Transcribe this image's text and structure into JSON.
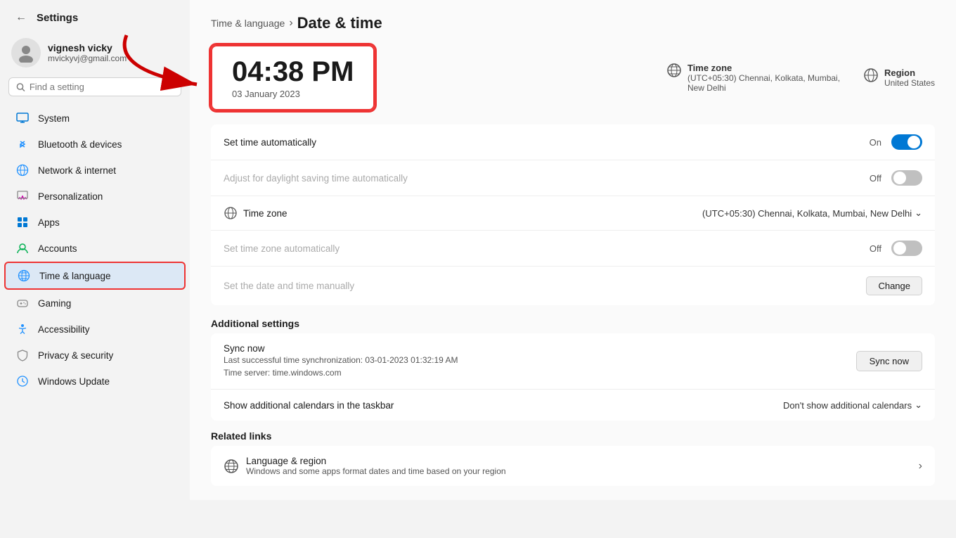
{
  "window": {
    "title": "Settings"
  },
  "user": {
    "name": "vignesh vicky",
    "email": "mvickyvj@gmail.com",
    "avatar_icon": "👤"
  },
  "search": {
    "placeholder": "Find a setting"
  },
  "nav": {
    "items": [
      {
        "id": "system",
        "label": "System",
        "icon": "🖥️",
        "active": false
      },
      {
        "id": "bluetooth",
        "label": "Bluetooth & devices",
        "icon": "🔵",
        "active": false
      },
      {
        "id": "network",
        "label": "Network & internet",
        "icon": "🌐",
        "active": false
      },
      {
        "id": "personalization",
        "label": "Personalization",
        "icon": "✏️",
        "active": false
      },
      {
        "id": "apps",
        "label": "Apps",
        "icon": "🧩",
        "active": false
      },
      {
        "id": "accounts",
        "label": "Accounts",
        "icon": "👤",
        "active": false
      },
      {
        "id": "time-language",
        "label": "Time & language",
        "icon": "🌍",
        "active": true
      },
      {
        "id": "gaming",
        "label": "Gaming",
        "icon": "🎮",
        "active": false
      },
      {
        "id": "accessibility",
        "label": "Accessibility",
        "icon": "♿",
        "active": false
      },
      {
        "id": "privacy-security",
        "label": "Privacy & security",
        "icon": "🛡️",
        "active": false
      },
      {
        "id": "windows-update",
        "label": "Windows Update",
        "icon": "🔄",
        "active": false
      }
    ]
  },
  "page": {
    "parent": "Time & language",
    "title": "Date & time",
    "time": "04:38 PM",
    "date": "03 January 2023",
    "timezone_label": "Time zone",
    "timezone_value": "(UTC+05:30) Chennai, Kolkata, Mumbai, New Delhi",
    "region_label": "Region",
    "region_value": "United States"
  },
  "settings": {
    "set_time_auto": {
      "label": "Set time automatically",
      "state": "On",
      "toggle": "on"
    },
    "daylight_saving": {
      "label": "Adjust for daylight saving time automatically",
      "state": "Off",
      "toggle": "off",
      "dimmed": true
    },
    "timezone": {
      "label": "Time zone",
      "value": "(UTC+05:30) Chennai, Kolkata, Mumbai, New Delhi",
      "has_icon": true
    },
    "set_tz_auto": {
      "label": "Set time zone automatically",
      "state": "Off",
      "toggle": "off",
      "dimmed": true
    },
    "set_date_manual": {
      "label": "Set the date and time manually",
      "button": "Change",
      "dimmed": true
    }
  },
  "additional_settings": {
    "header": "Additional settings",
    "sync": {
      "title": "Sync now",
      "last_sync": "Last successful time synchronization: 03-01-2023 01:32:19 AM",
      "server": "Time server: time.windows.com",
      "button": "Sync now"
    },
    "calendars": {
      "label": "Show additional calendars in the taskbar",
      "value": "Don't show additional calendars"
    }
  },
  "related_links": {
    "header": "Related links",
    "items": [
      {
        "icon": "🌐",
        "title": "Language & region",
        "sub": "Windows and some apps format dates and time based on your region"
      }
    ]
  }
}
